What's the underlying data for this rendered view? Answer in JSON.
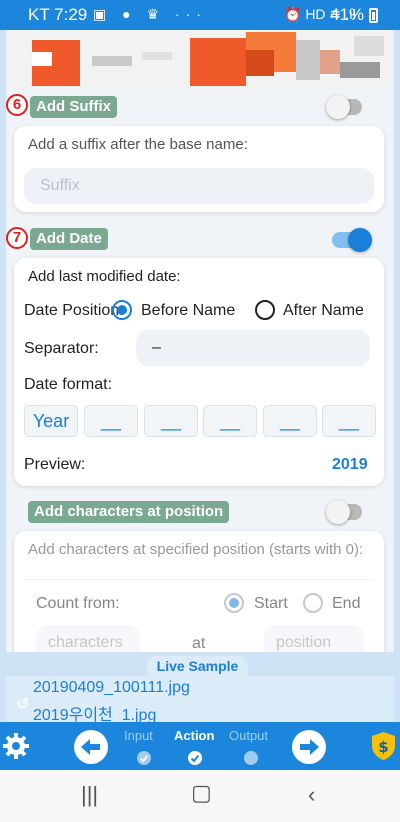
{
  "status": {
    "time": "KT 7:29",
    "left_icons": "▣ ● ♛ ···",
    "right_icons": "⏰ HD ≋ .ıl",
    "battery": "41%"
  },
  "sections": {
    "suffix": {
      "number": "6",
      "tag": "Add Suffix",
      "enabled": false,
      "description": "Add a suffix after the base name:",
      "input_placeholder": "Suffix"
    },
    "date": {
      "number": "7",
      "tag": "Add Date",
      "enabled": true,
      "description": "Add last modified date:",
      "position_label": "Date Position:",
      "position_options": [
        "Before Name",
        "After Name"
      ],
      "position_selected": "Before Name",
      "separator_label": "Separator:",
      "separator_value": "–",
      "format_label": "Date format:",
      "format_segments": [
        "Year",
        "__",
        "__",
        "__",
        "__",
        "__"
      ],
      "preview_label": "Preview:",
      "preview_value": "2019"
    },
    "chars": {
      "tag": "Add characters at position",
      "enabled": false,
      "description": "Add characters at specified position (starts with 0):",
      "count_from_label": "Count from:",
      "count_options": [
        "Start",
        "End"
      ],
      "count_selected": "Start",
      "characters_placeholder": "characters",
      "at_label": "at",
      "position_placeholder": "position"
    }
  },
  "live_sample": {
    "label": "Live Sample",
    "files": [
      "20190409_100111.jpg",
      "2019우이천_1.jpg"
    ]
  },
  "steps": {
    "items": [
      "Input",
      "Action",
      "Output"
    ],
    "active": "Action"
  },
  "colors": {
    "brand": "#1c86dc",
    "accent": "#1a7fd6",
    "tag_green": "#7aa890",
    "marker_red": "#e02020"
  }
}
